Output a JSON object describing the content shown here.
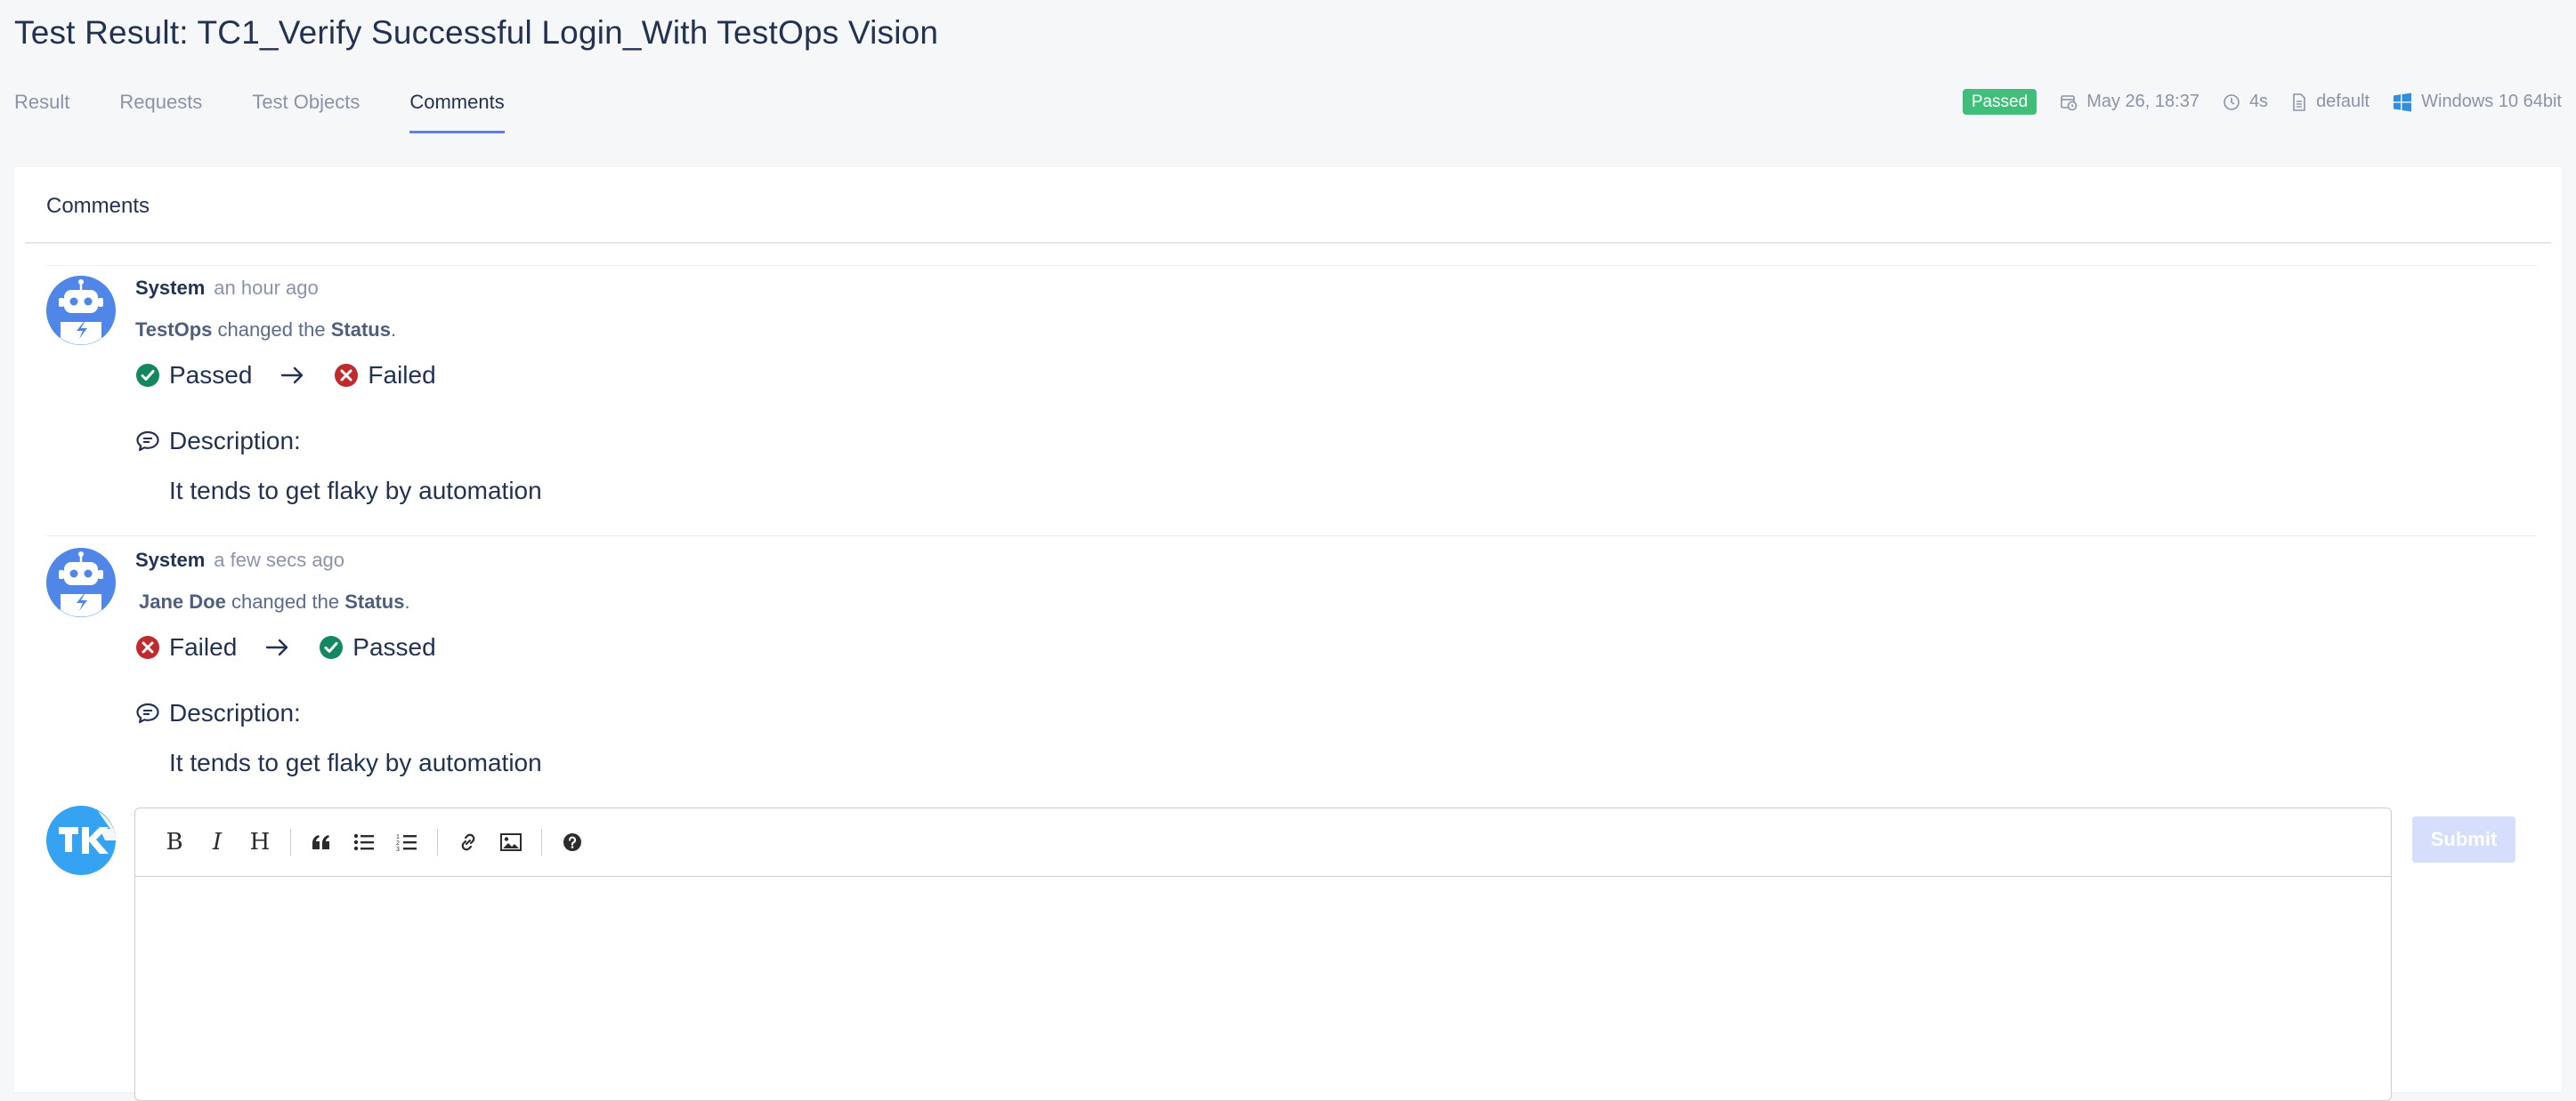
{
  "page": {
    "title": "Test Result: TC1_Verify Successful Login_With TestOps Vision"
  },
  "tabs": [
    {
      "label": "Result"
    },
    {
      "label": "Requests"
    },
    {
      "label": "Test Objects"
    },
    {
      "label": "Comments",
      "active": true
    }
  ],
  "meta": {
    "status": "Passed",
    "date": "May 26, 18:37",
    "duration": "4s",
    "profile": "default",
    "platform": "Windows 10 64bit"
  },
  "comments_panel": {
    "title": "Comments",
    "comments": [
      {
        "author": "System",
        "time": "an hour ago",
        "actor": "TestOps",
        "changed_text": "changed the",
        "field": "Status",
        "period": ".",
        "from_status": "Passed",
        "to_status": "Failed",
        "description_label": "Description:",
        "description": "It tends to get flaky by automation"
      },
      {
        "author": "System",
        "time": "a few secs ago",
        "actor": "Jane Doe",
        "changed_text": "changed the",
        "field": "Status",
        "period": ".",
        "from_status": "Failed",
        "to_status": "Passed",
        "description_label": "Description:",
        "description": "It tends to get flaky by automation"
      }
    ]
  },
  "editor": {
    "toolbar": [
      "bold",
      "italic",
      "heading",
      "quote",
      "unordered-list",
      "ordered-list",
      "link",
      "image",
      "help"
    ],
    "bold_label": "B",
    "italic_label": "I",
    "heading_label": "H",
    "submit_label": "Submit"
  },
  "colors": {
    "accent": "#5d7ee6",
    "passed": "#13875f",
    "failed": "#c0292d",
    "badge_passed": "#3fbf7a",
    "submit_disabled": "#d5defa"
  }
}
